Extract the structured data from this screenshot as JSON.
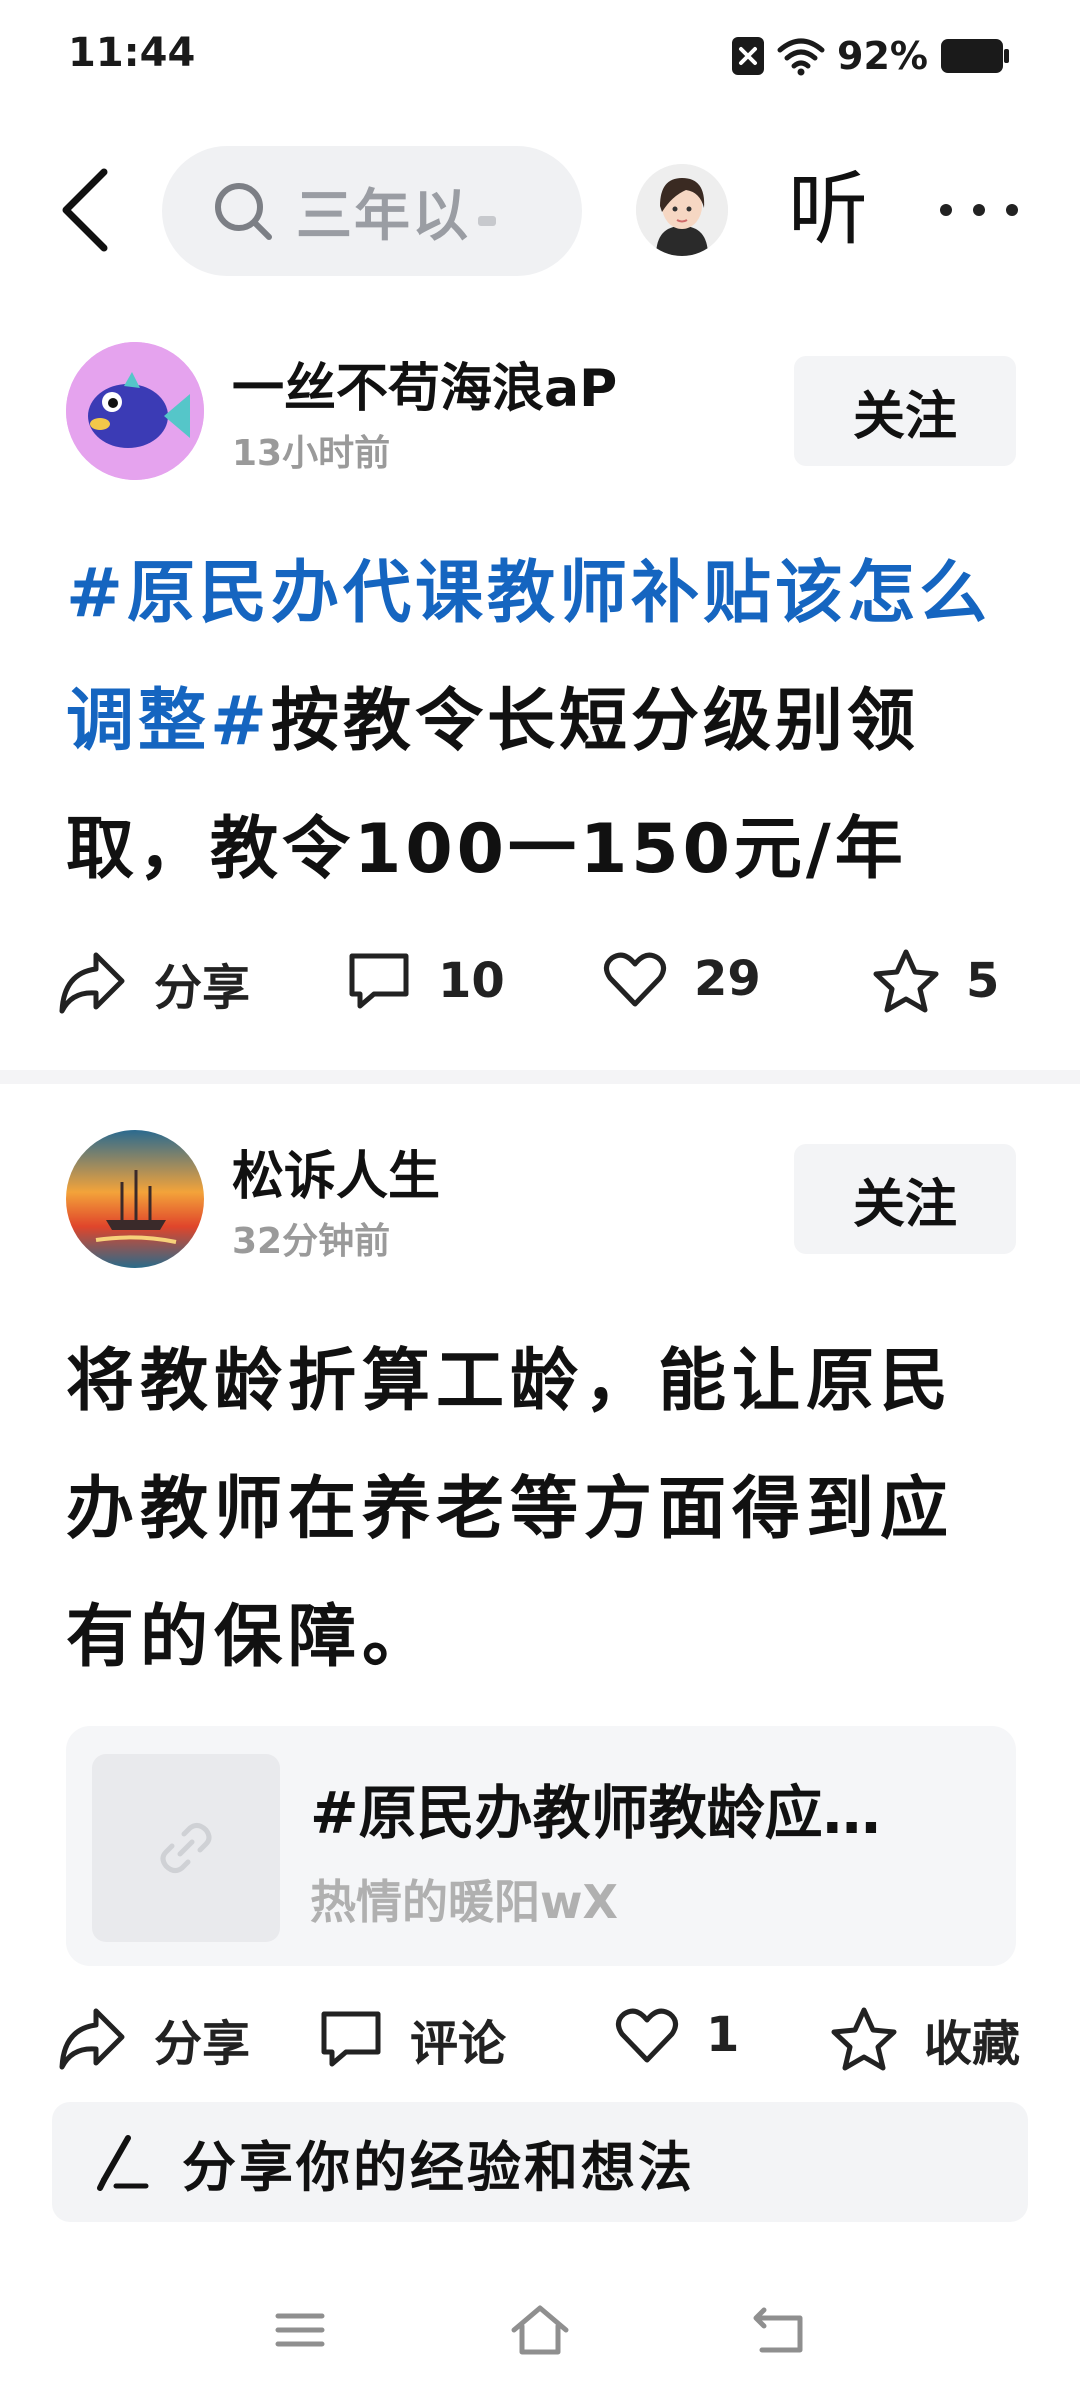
{
  "status": {
    "time": "11:44",
    "battery": "92%"
  },
  "nav": {
    "search_text": "三年以",
    "listen_label": "听"
  },
  "posts": [
    {
      "author": "一丝不苟海浪aP",
      "time": "13小时前",
      "follow_label": "关注",
      "hashtag": "#原民办代课教师补贴该怎么调整#",
      "text": "按教令长短分级别领取，教令100一150元/年",
      "actions": {
        "share": "分享",
        "comments": "10",
        "likes": "29",
        "favorites": "5"
      }
    },
    {
      "author": "松诉人生",
      "time": "32分钟前",
      "follow_label": "关注",
      "text": "将教龄折算工龄，能让原民办教师在养老等方面得到应有的保障。",
      "quote": {
        "title": "#原民办教师教龄应…",
        "author": "热情的暖阳wX"
      },
      "actions": {
        "share": "分享",
        "comment": "评论",
        "likes": "1",
        "favorite": "收藏"
      }
    }
  ],
  "comment_box": {
    "placeholder": "分享你的经验和想法"
  },
  "colors": {
    "hashtag": "#1565c0",
    "follow_bg": "#f3f4f6",
    "muted": "#9a9a9a"
  }
}
